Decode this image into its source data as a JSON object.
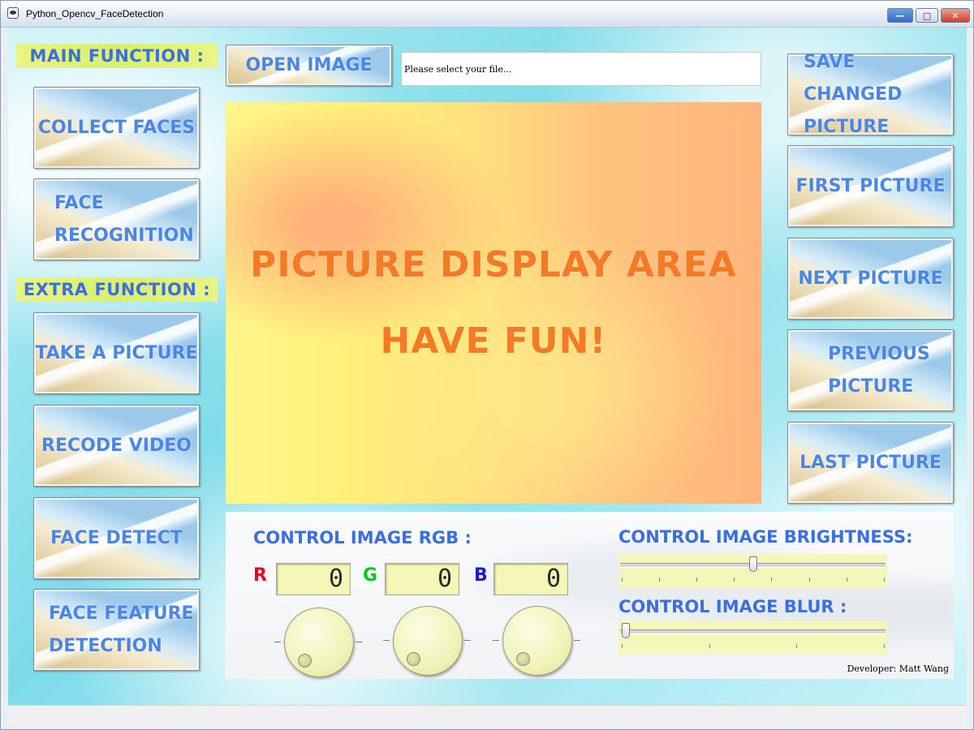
{
  "window": {
    "title": "Python_Opencv_FaceDetection",
    "icon": "app-window-icon",
    "controls": {
      "minimize": "—",
      "maximize": "□",
      "close": "✕"
    }
  },
  "left_panel": {
    "main_label": "MAIN FUNCTION :",
    "main_buttons": [
      "COLLECT FACES",
      "FACE RECOGNITION"
    ],
    "main_button_lines": [
      [
        "COLLECT FACES"
      ],
      [
        "FACE",
        "RECOGNITION"
      ]
    ],
    "extra_label": "EXTRA FUNCTION :",
    "extra_button_lines": [
      [
        "TAKE A PICTURE"
      ],
      [
        "RECODE VIDEO"
      ],
      [
        "FACE DETECT"
      ],
      [
        "FACE FEATURE",
        "DETECTION"
      ]
    ]
  },
  "top_bar": {
    "open_button": "OPEN IMAGE",
    "file_path_text": "Please select your file..."
  },
  "picture_area": {
    "line1": "PICTURE DISPLAY AREA",
    "line2": "HAVE FUN!"
  },
  "right_panel": {
    "save_lines": [
      "SAVE CHANGED",
      "PICTURE"
    ],
    "first": "FIRST PICTURE",
    "next": "NEXT PICTURE",
    "previous_lines": [
      "PREVIOUS",
      "PICTURE"
    ],
    "last": "LAST PICTURE"
  },
  "controls": {
    "rgb_heading": "CONTROL IMAGE RGB :",
    "r_label": "R",
    "g_label": "G",
    "b_label": "B",
    "r_value": "0",
    "g_value": "0",
    "b_value": "0",
    "brightness_heading": "CONTROL IMAGE BRIGHTNESS:",
    "brightness_level": 0.5,
    "blur_heading": "CONTROL IMAGE BLUR :",
    "blur_level": 0.0,
    "developer": "Developer: Matt Wang"
  },
  "colors": {
    "accent_blue": "#4a86e8",
    "display_orange": "#f47a26",
    "label_yellow": "#e2f27a",
    "r_color": "#e8001c",
    "g_color": "#00c81e",
    "b_color": "#1c1ccc"
  }
}
